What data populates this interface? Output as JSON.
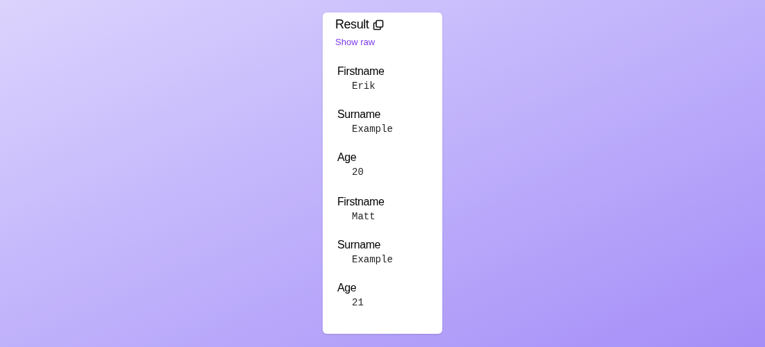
{
  "card": {
    "title": "Result",
    "link": "Show raw"
  },
  "records": [
    {
      "fields": [
        {
          "label": "Firstname",
          "value": "Erik"
        },
        {
          "label": "Surname",
          "value": "Example"
        },
        {
          "label": "Age",
          "value": "20"
        }
      ]
    },
    {
      "fields": [
        {
          "label": "Firstname",
          "value": "Matt"
        },
        {
          "label": "Surname",
          "value": "Example"
        },
        {
          "label": "Age",
          "value": "21"
        }
      ]
    }
  ]
}
